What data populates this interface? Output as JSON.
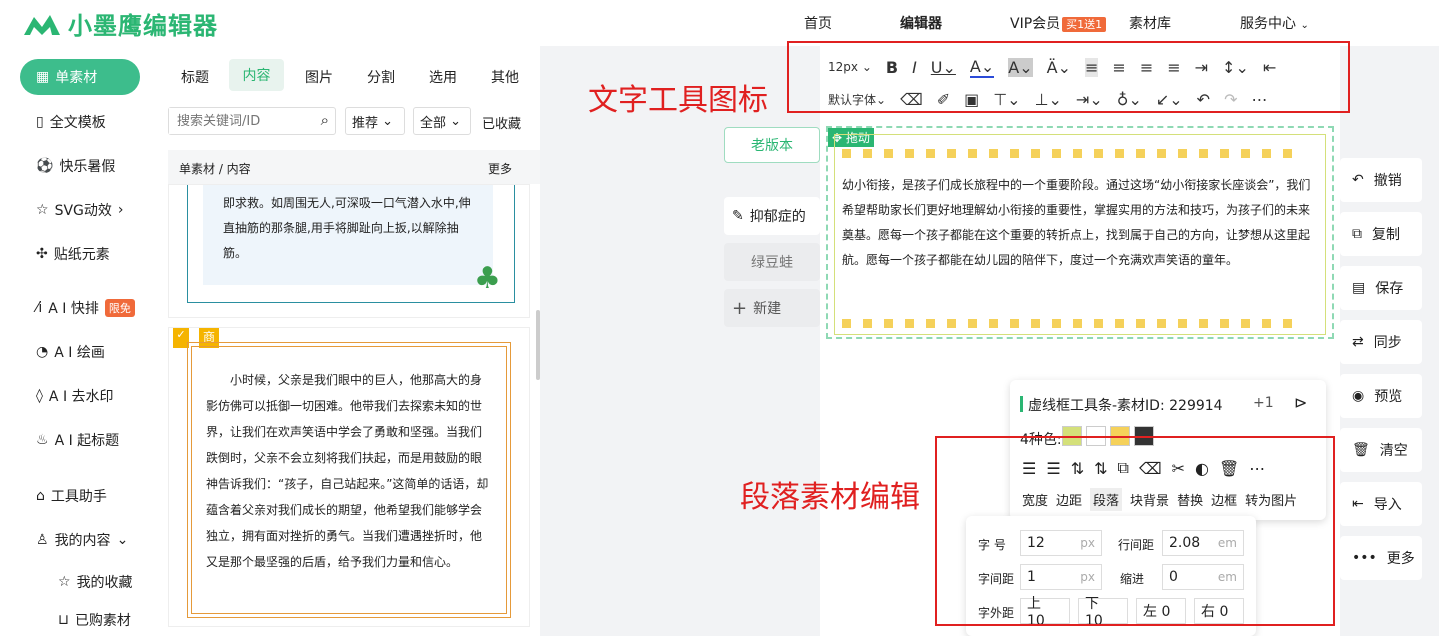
{
  "brand": {
    "name": "小墨鹰编辑器"
  },
  "nav": {
    "home": "首页",
    "editor": "编辑器",
    "vip": "VIP会员",
    "vip_badge": "买1送1",
    "materials": "素材库",
    "service": "服务中心"
  },
  "sidebar": {
    "items": [
      {
        "label": "单素材"
      },
      {
        "label": "全文模板"
      },
      {
        "label": "快乐暑假"
      },
      {
        "label": "SVG动效"
      },
      {
        "label": "贴纸元素"
      },
      {
        "label": "A I 快排",
        "badge": "限免"
      },
      {
        "label": "A I 绘画"
      },
      {
        "label": "A I 去水印"
      },
      {
        "label": "A I 起标题"
      },
      {
        "label": "工具助手"
      },
      {
        "label": "我的内容"
      },
      {
        "label": "我的收藏"
      },
      {
        "label": "已购素材"
      }
    ]
  },
  "tabs": [
    "标题",
    "内容",
    "图片",
    "分割",
    "选用",
    "其他"
  ],
  "search": {
    "placeholder": "搜索关键词/ID",
    "sort": "推荐",
    "filter": "全部",
    "favorites": "已收藏"
  },
  "breadcrumb": {
    "path": "单素材 / 内容",
    "more": "更多"
  },
  "card1": {
    "text": "即求救。如周围无人,可深吸一口气潜入水中,伸直抽筋的那条腿,用手将脚趾向上扳,以解除抽筋。"
  },
  "card2": {
    "tag": "商",
    "text": "小时候，父亲是我们眼中的巨人，他那高大的身影仿佛可以抵御一切困难。他带我们去探索未知的世界，让我们在欢声笑语中学会了勇敢和坚强。当我们跌倒时，父亲不会立刻将我们扶起，而是用鼓励的眼神告诉我们：“孩子，自己站起来。”这简单的话语，却蕴含着父亲对我们成长的期望，他希望我们能够学会独立，拥有面对挫折的勇气。当我们遭遇挫折时，他又是那个最坚强的后盾，给予我们力量和信心。"
  },
  "docs": {
    "old_version": "老版本",
    "doc1": "抑郁症的",
    "doc2": "绿豆蛙",
    "new": "新建"
  },
  "toolbar": {
    "font_size": "12px",
    "font_family": "默认字体"
  },
  "annotations": {
    "text_tools": "文字工具图标",
    "paragraph_edit": "段落素材编辑"
  },
  "editor": {
    "drag": "拖动",
    "content": "幼小衔接，是孩子们成长旅程中的一个重要阶段。通过这场“幼小衔接家长座谈会”，我们希望帮助家长们更好地理解幼小衔接的重要性，掌握实用的方法和技巧，为孩子们的未来奠基。愿每一个孩子都能在这个重要的转折点上，找到属于自己的方向，让梦想从这里起航。愿每一个孩子都能在幼儿园的陪伴下，度过一个充满欢声笑语的童年。"
  },
  "right_actions": [
    "撤销",
    "复制",
    "保存",
    "同步",
    "预览",
    "清空",
    "导入",
    "更多"
  ],
  "panel": {
    "title": "虚线框工具条-素材ID: 229914",
    "plus": "+1",
    "colors_label": "4种色:",
    "colors": [
      "#d4e07a",
      "#ffffff",
      "#f5d15a",
      "#333333"
    ],
    "tools": [
      "宽度",
      "边距",
      "段落",
      "块背景",
      "替换",
      "边框",
      "转为图片"
    ]
  },
  "para": {
    "font_size_label": "字 号",
    "font_size": "12",
    "line_height_label": "行间距",
    "line_height": "2.08",
    "letter_spacing_label": "字间距",
    "letter_spacing": "1",
    "indent_label": "缩进",
    "indent": "0",
    "margin_label": "字外距",
    "top": "上 10",
    "bottom": "下 10",
    "left": "左 0",
    "right": "右 0",
    "unit_px": "px",
    "unit_em": "em"
  }
}
